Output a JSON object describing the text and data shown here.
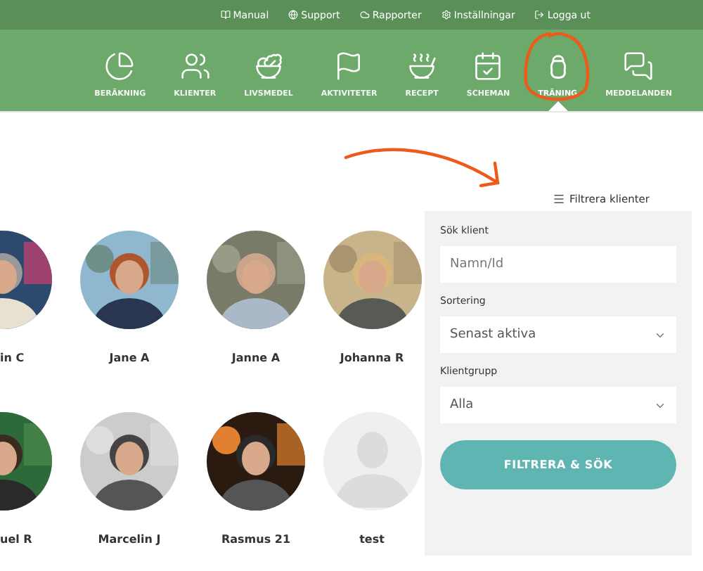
{
  "top_links": [
    {
      "label": "Manual"
    },
    {
      "label": "Support"
    },
    {
      "label": "Rapporter"
    },
    {
      "label": "Inställningar"
    },
    {
      "label": "Logga ut"
    }
  ],
  "nav": [
    {
      "label": "BERÄKNING",
      "selected": false
    },
    {
      "label": "KLIENTER",
      "selected": false
    },
    {
      "label": "LIVSMEDEL",
      "selected": false
    },
    {
      "label": "AKTIVITETER",
      "selected": false
    },
    {
      "label": "RECEPT",
      "selected": false
    },
    {
      "label": "SCHEMAN",
      "selected": false
    },
    {
      "label": "TRÄNING",
      "selected": true
    },
    {
      "label": "MEDDELANDEN",
      "selected": false
    }
  ],
  "filter_toggle": "Filtrera klienter",
  "clients": [
    {
      "name": "in C"
    },
    {
      "name": "Jane A"
    },
    {
      "name": "Janne A"
    },
    {
      "name": "Johanna R"
    },
    {
      "name": "uel R"
    },
    {
      "name": "Marcelin J"
    },
    {
      "name": "Rasmus 21"
    },
    {
      "name": "test",
      "kind": "placeholder"
    }
  ],
  "filter_panel": {
    "search_label": "Sök klient",
    "search_placeholder": "Namn/Id",
    "sort_label": "Sortering",
    "sort_value": "Senast aktiva",
    "group_label": "Klientgrupp",
    "group_value": "Alla",
    "submit": "FILTRERA & SÖK"
  }
}
